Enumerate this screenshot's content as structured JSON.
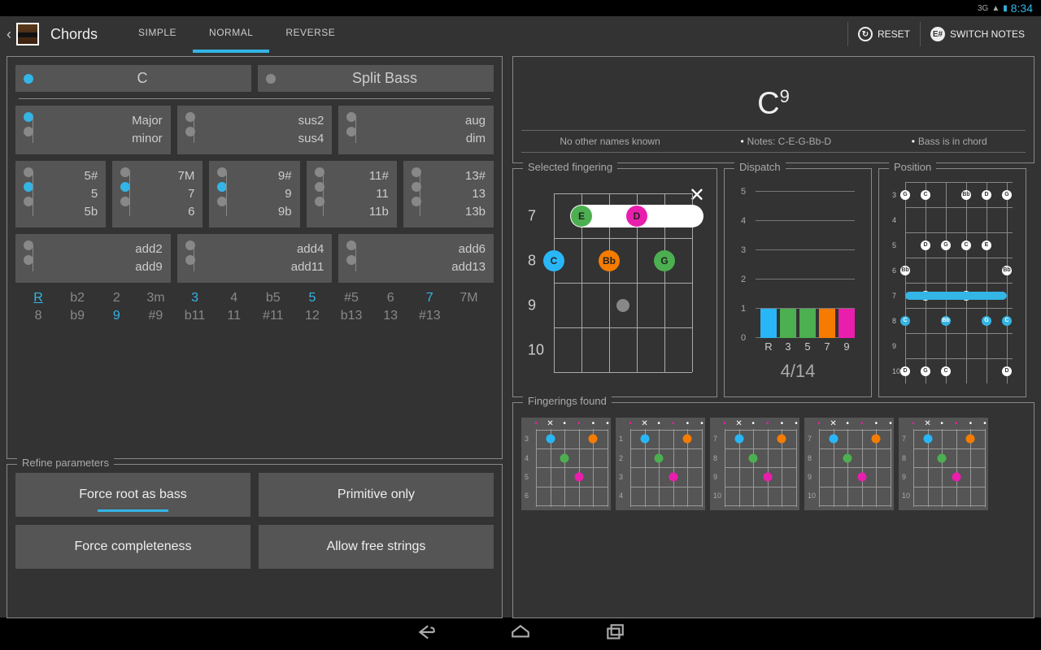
{
  "status": {
    "network": "3G",
    "clock": "8:34"
  },
  "header": {
    "title": "Chords",
    "tabs": [
      "SIMPLE",
      "NORMAL",
      "REVERSE"
    ],
    "active_tab": 1,
    "reset": "RESET",
    "switch_notes": "SWITCH NOTES",
    "switch_glyph": "E#"
  },
  "root": {
    "selected": "C",
    "split_bass": "Split Bass",
    "split_on": false
  },
  "quality": {
    "col1": [
      "Major",
      "minor"
    ],
    "col2": [
      "sus2",
      "sus4"
    ],
    "col3": [
      "aug",
      "dim"
    ],
    "selected": [
      0,
      null,
      null
    ]
  },
  "tensions": [
    {
      "opts": [
        "5#",
        "5",
        "5b"
      ],
      "sel": 1
    },
    {
      "opts": [
        "7M",
        "7",
        "6"
      ],
      "sel": 1
    },
    {
      "opts": [
        "9#",
        "9",
        "9b"
      ],
      "sel": 1
    },
    {
      "opts": [
        "11#",
        "11",
        "11b"
      ],
      "sel": null
    },
    {
      "opts": [
        "13#",
        "13",
        "13b"
      ],
      "sel": null
    }
  ],
  "adds": [
    {
      "opts": [
        "add2",
        "add9"
      ]
    },
    {
      "opts": [
        "add4",
        "add11"
      ]
    },
    {
      "opts": [
        "add6",
        "add13"
      ]
    }
  ],
  "intervals": {
    "row1": [
      "R",
      "b2",
      "2",
      "3m",
      "3",
      "4",
      "b5",
      "5",
      "#5",
      "6",
      "7",
      "7M"
    ],
    "row2": [
      "8",
      "b9",
      "9",
      "#9",
      "b11",
      "11",
      "#11",
      "12",
      "b13",
      "13",
      "#13",
      ""
    ],
    "highlighted": [
      "R",
      "3",
      "5",
      "7",
      "9"
    ]
  },
  "refine": {
    "title": "Refine parameters",
    "buttons": [
      {
        "label": "Force root as bass",
        "active": true
      },
      {
        "label": "Primitive only",
        "active": false
      },
      {
        "label": "Force completeness",
        "active": false
      },
      {
        "label": "Allow free strings",
        "active": false
      }
    ]
  },
  "chord": {
    "name": "C",
    "ext": "9",
    "info": [
      "No other names known",
      "Notes: C-E-G-Bb-D",
      "Bass is in chord"
    ]
  },
  "selected_fingering": {
    "title": "Selected fingering",
    "frets": [
      7,
      8,
      9,
      10
    ],
    "barre": {
      "from": 1,
      "to": 5,
      "fret": 0
    },
    "notes": [
      {
        "string": 1,
        "fret": 0,
        "label": "E",
        "color": "#4CAF50"
      },
      {
        "string": 3,
        "fret": 0,
        "label": "D",
        "color": "#E91EAC"
      },
      {
        "string": 0,
        "fret": 1,
        "label": "C",
        "color": "#29B6F6"
      },
      {
        "string": 2,
        "fret": 1,
        "label": "Bb",
        "color": "#F57C00"
      },
      {
        "string": 4,
        "fret": 1,
        "label": "G",
        "color": "#4CAF50"
      }
    ],
    "marker": {
      "string": 2.5,
      "fret": 2
    }
  },
  "chart_data": {
    "type": "bar",
    "title": "Dispatch",
    "categories": [
      "R",
      "3",
      "5",
      "7",
      "9"
    ],
    "values": [
      1,
      1,
      1,
      1,
      1
    ],
    "ylim": [
      0,
      5
    ],
    "colors": [
      "#29B6F6",
      "#4CAF50",
      "#4CAF50",
      "#F57C00",
      "#E91EAC"
    ],
    "counter": "4/14"
  },
  "position": {
    "title": "Position",
    "frets": [
      3,
      4,
      5,
      6,
      7,
      8,
      9,
      10
    ],
    "highlight_barre_fret": 7
  },
  "fingerings": {
    "title": "Fingerings found",
    "items": [
      {
        "frets": [
          3,
          4,
          5,
          6
        ]
      },
      {
        "frets": [
          1,
          2,
          3,
          4
        ]
      },
      {
        "frets": [
          7,
          8,
          9,
          10
        ]
      },
      {
        "frets": [
          7,
          8,
          9,
          10
        ]
      },
      {
        "frets": [
          7,
          8,
          9,
          10
        ]
      }
    ]
  }
}
